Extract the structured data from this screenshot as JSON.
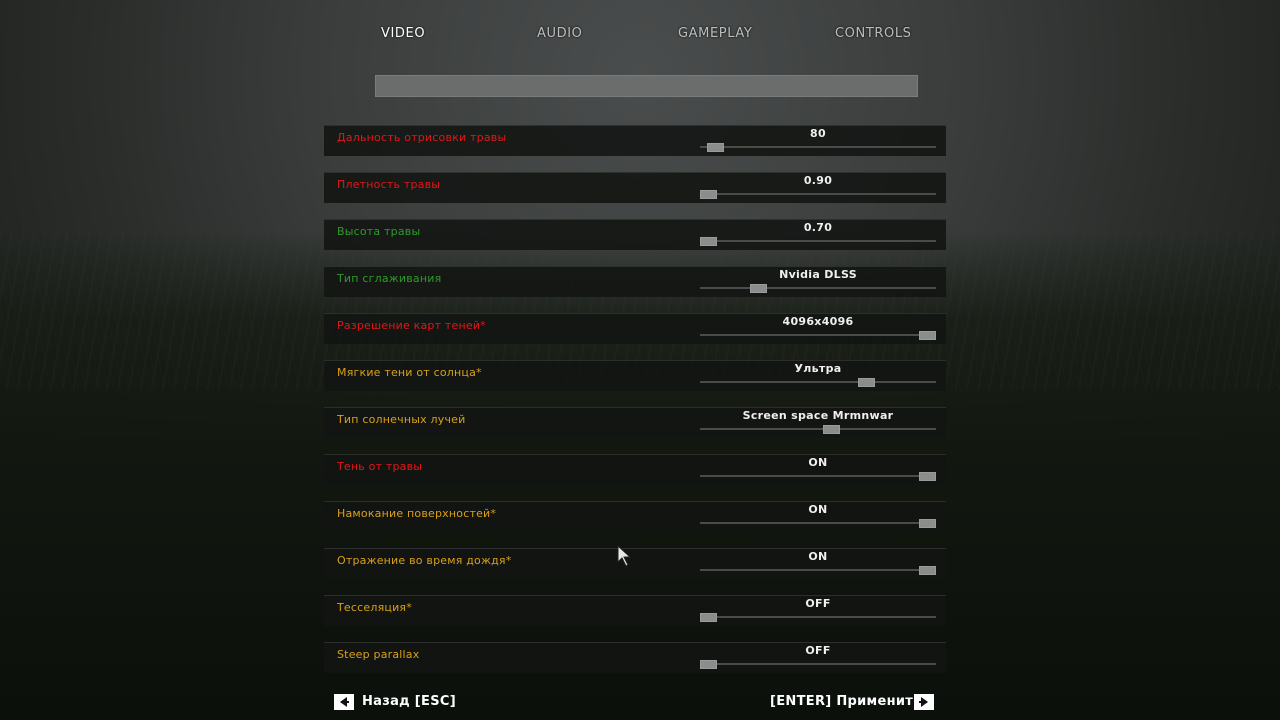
{
  "tabs": [
    {
      "label": "VIDEO",
      "active": true
    },
    {
      "label": "AUDIO",
      "active": false
    },
    {
      "label": "GAMEPLAY",
      "active": false
    },
    {
      "label": "CONTROLS",
      "active": false
    }
  ],
  "search": {
    "value": ""
  },
  "colors": {
    "red": "#e01818",
    "green": "#2e9b2a",
    "orange": "#d9a11a"
  },
  "settings": [
    {
      "label": "Дальность отрисовки травы",
      "value": "80",
      "color": "red",
      "level": 0.03
    },
    {
      "label": "Плетность травы",
      "value": "0.90",
      "color": "red",
      "level": 0.0
    },
    {
      "label": "Высота травы",
      "value": "0.70",
      "color": "green",
      "level": 0.0
    },
    {
      "label": "Тип сглаживания",
      "value": "Nvidia DLSS",
      "color": "green",
      "level": 0.23
    },
    {
      "label": "Разрешение карт теней*",
      "value": "4096x4096",
      "color": "red",
      "level": 1.0
    },
    {
      "label": "Мягкие тени от солнца*",
      "value": "Ультра",
      "color": "orange",
      "level": 0.72
    },
    {
      "label": "Тип солнечных лучей",
      "value": "Screen space Mrmnwar",
      "color": "orange",
      "level": 0.56
    },
    {
      "label": "Тень от травы",
      "value": "ON",
      "color": "red",
      "level": 1.0
    },
    {
      "label": "Намокание поверхностей*",
      "value": "ON",
      "color": "orange",
      "level": 1.0
    },
    {
      "label": "Отражение во время дождя*",
      "value": "ON",
      "color": "orange",
      "level": 1.0
    },
    {
      "label": "Тесселяция*",
      "value": "OFF",
      "color": "orange",
      "level": 0.0
    },
    {
      "label": "Steep parallax",
      "value": "OFF",
      "color": "orange",
      "level": 0.0
    }
  ],
  "footer": {
    "back_label": "Назад [ESC]",
    "back_icon": "left-arrow-icon",
    "apply_label": "[ENTER] Применить",
    "apply_icon": "right-arrow-icon"
  }
}
